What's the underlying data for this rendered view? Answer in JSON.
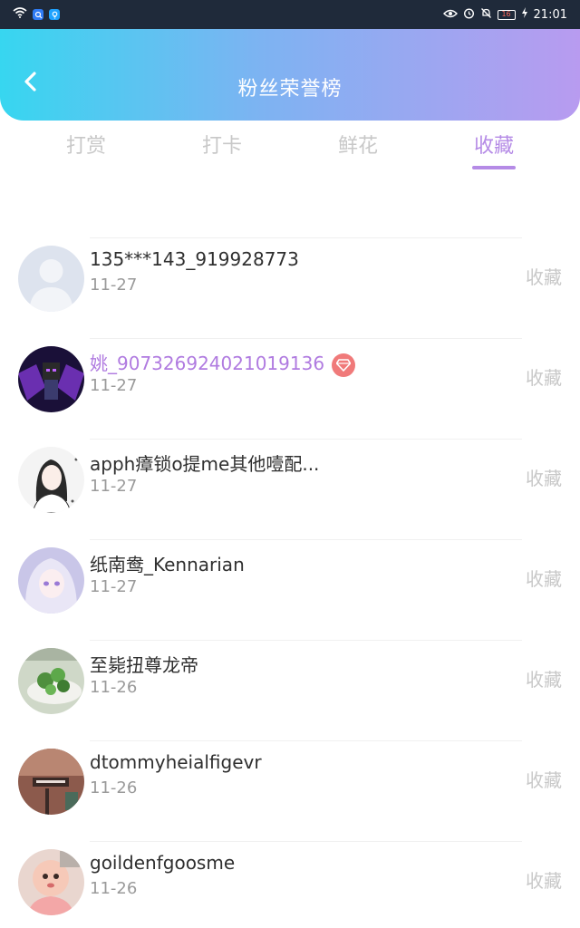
{
  "status_bar": {
    "time": "21:01",
    "battery": "16",
    "left_icons": [
      "wifi-icon",
      "search-app-icon",
      "bulb-app-icon"
    ],
    "right_icons": [
      "eye-icon",
      "alarm-icon",
      "bell-mute-icon",
      "battery-icon",
      "charging-icon"
    ]
  },
  "header": {
    "title": "粉丝荣誉榜",
    "back_icon": "chevron-left-icon"
  },
  "tabs": [
    {
      "label": "打赏",
      "active": false
    },
    {
      "label": "打卡",
      "active": false
    },
    {
      "label": "鲜花",
      "active": false
    },
    {
      "label": "收藏",
      "active": true
    }
  ],
  "list": {
    "partial_date": "11-27",
    "action_label": "收藏",
    "rows": [
      {
        "name": "135***143_919928773",
        "date": "11-27",
        "action": "收藏",
        "highlight": false
      },
      {
        "name": "姚_907326924021019136",
        "date": "11-27",
        "action": "收藏",
        "highlight": true,
        "badge": "diamond-icon"
      },
      {
        "name": "apph瘴锁o提me其他噎配...",
        "date": "11-27",
        "action": "收藏",
        "highlight": false
      },
      {
        "name": "纸南鸯_Kennarian",
        "date": "11-27",
        "action": "收藏",
        "highlight": false
      },
      {
        "name": "至毙扭尊龙帝",
        "date": "11-26",
        "action": "收藏",
        "highlight": false
      },
      {
        "name": "dtommyheialfigevr",
        "date": "11-26",
        "action": "收藏",
        "highlight": false
      },
      {
        "name": "goildenfgoosme",
        "date": "11-26",
        "action": "收藏",
        "highlight": false
      }
    ]
  },
  "colors": {
    "accent": "#b58be6",
    "gradient_start": "#37d6f0",
    "gradient_end": "#b89bf0",
    "inactive_tab": "#c8c8c8",
    "vip_badge": "#f07a7a"
  }
}
